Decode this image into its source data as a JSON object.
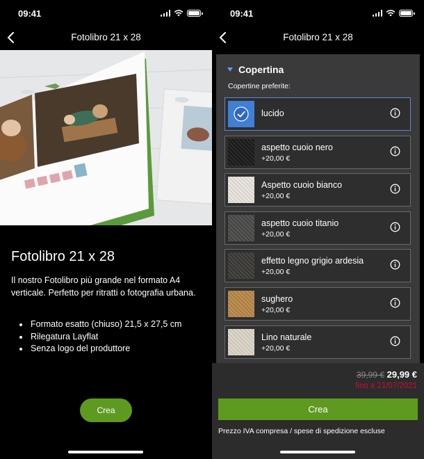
{
  "status_bar": {
    "time": "09:41"
  },
  "left": {
    "nav_title": "Fotolibro 21 x 28",
    "product_title": "Fotolibro 21 x 28",
    "description": "Il nostro Fotolibro più grande nel formato A4 verticale. Perfetto per ritratti o fotografia urbana.",
    "bullets": [
      "Formato esatto (chiuso) 21,5 x 27,5 cm",
      "Rilegatura Layflat",
      "Senza logo del produttore"
    ],
    "create_label": "Crea"
  },
  "right": {
    "nav_title": "Fotolibro 21 x 28",
    "section_title": "Copertina",
    "subsection_label": "Copertine preferite:",
    "options": [
      {
        "name": "lucido",
        "price": "",
        "selected": true,
        "swatch_color": "#3f7fd6"
      },
      {
        "name": "aspetto cuoio nero",
        "price": "+20,00 €",
        "selected": false,
        "swatch_color": "#1a1a1a"
      },
      {
        "name": "Aspetto cuoio bianco",
        "price": "+20,00 €",
        "selected": false,
        "swatch_color": "#e9e4dc"
      },
      {
        "name": "aspetto cuoio titanio",
        "price": "+20,00 €",
        "selected": false,
        "swatch_color": "#4a4a48"
      },
      {
        "name": "effetto legno grigio ardesia",
        "price": "+20,00 €",
        "selected": false,
        "swatch_color": "#3c3936"
      },
      {
        "name": "sughero",
        "price": "+20,00 €",
        "selected": false,
        "swatch_color": "#b98848"
      },
      {
        "name": "Lino naturale",
        "price": "+20,00 €",
        "selected": false,
        "swatch_color": "#dcd6c8"
      }
    ],
    "price_old": "39,99 €",
    "price_new": "29,99 €",
    "price_until": "fino a 21/07/2021",
    "create_label": "Crea",
    "note": "Prezzo IVA compresa / spese di spedizione escluse"
  },
  "colors": {
    "accent_green": "#5e9a20",
    "accent_blue": "#5c9cf0",
    "sale_red": "#c8102e",
    "panel_bg": "#3a3a3a"
  }
}
